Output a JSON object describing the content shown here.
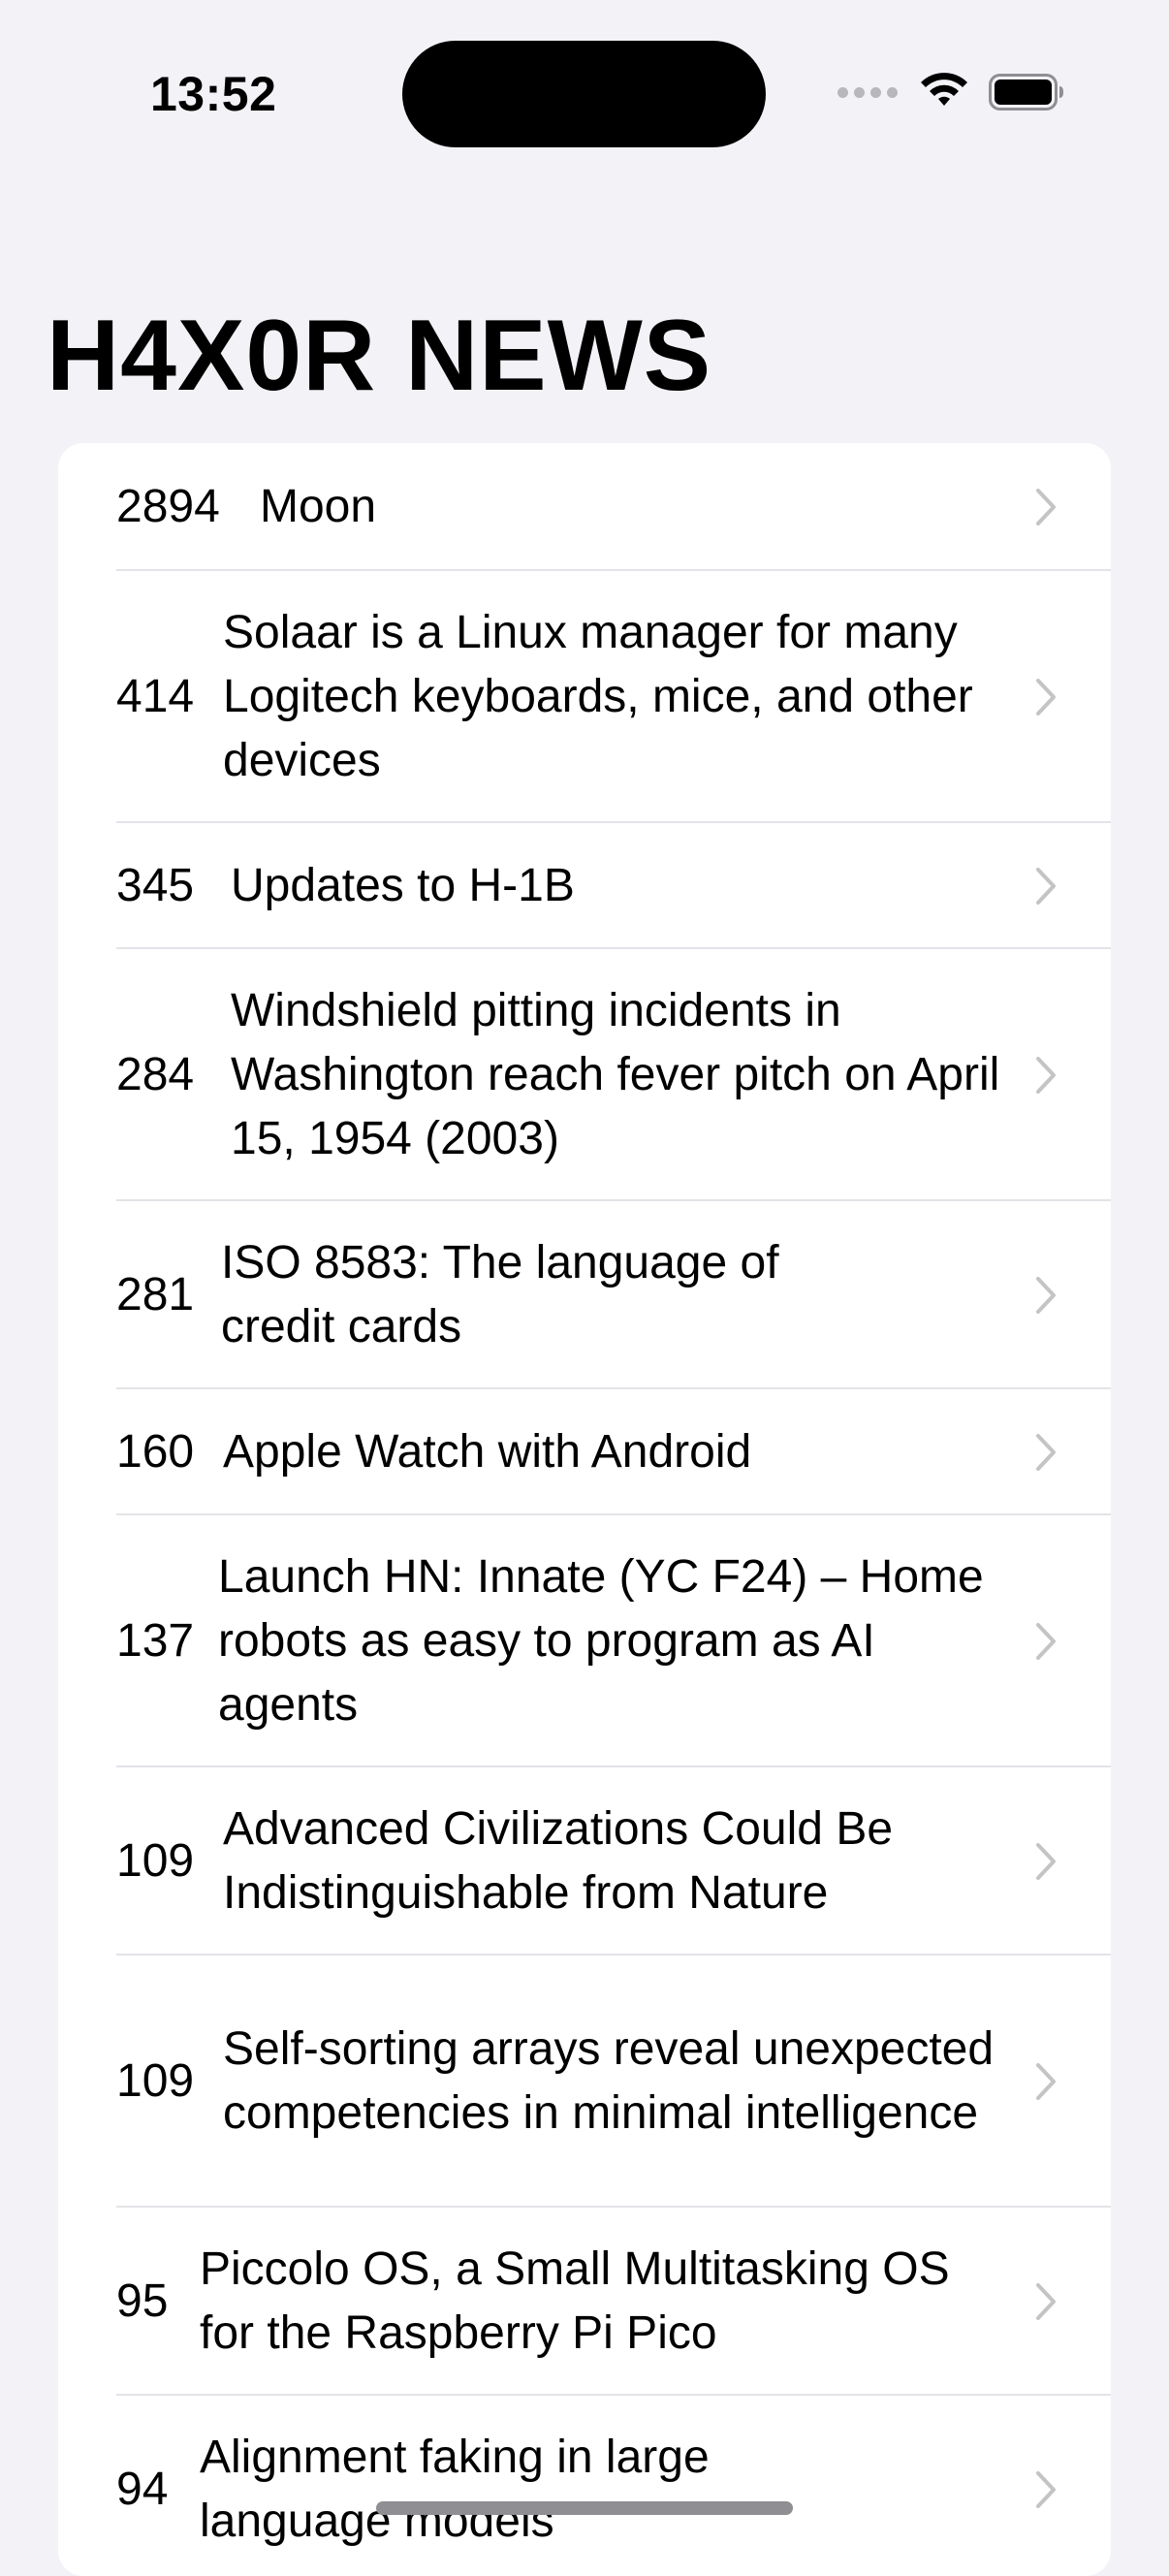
{
  "status_bar": {
    "time": "13:52"
  },
  "header": {
    "title": "H4X0R NEWS"
  },
  "stories": [
    {
      "score": "2894",
      "title": "Moon"
    },
    {
      "score": "414",
      "title": "Solaar is a Linux manager for many Logitech keyboards, mice, and other devices"
    },
    {
      "score": "345",
      "title": "Updates to H-1B"
    },
    {
      "score": "284",
      "title": "Windshield pitting incidents in Washington reach fever pitch on April 15, 1954 (2003)"
    },
    {
      "score": "281",
      "title": "ISO 8583: The language of credit cards"
    },
    {
      "score": "160",
      "title": "Apple Watch with Android"
    },
    {
      "score": "137",
      "title": "Launch HN: Innate (YC F24) – Home robots as easy to program as AI agents"
    },
    {
      "score": "109",
      "title": "Advanced Civilizations Could Be Indistinguishable from Nature"
    },
    {
      "score": "109",
      "title": "Self-sorting arrays reveal unexpected competencies in minimal intelligence"
    },
    {
      "score": "95",
      "title": "Piccolo OS, a Small Multitasking OS for the Raspberry Pi Pico"
    },
    {
      "score": "94",
      "title": "Alignment faking in large language models"
    }
  ],
  "icons": {
    "wifi": "wifi-icon",
    "battery": "battery-icon",
    "chevron": "chevron-right-icon"
  },
  "colors": {
    "background": "#F2F2F7",
    "card": "#FFFFFF",
    "separator": "#E3E3E8",
    "chevron": "#C4C4C7"
  }
}
